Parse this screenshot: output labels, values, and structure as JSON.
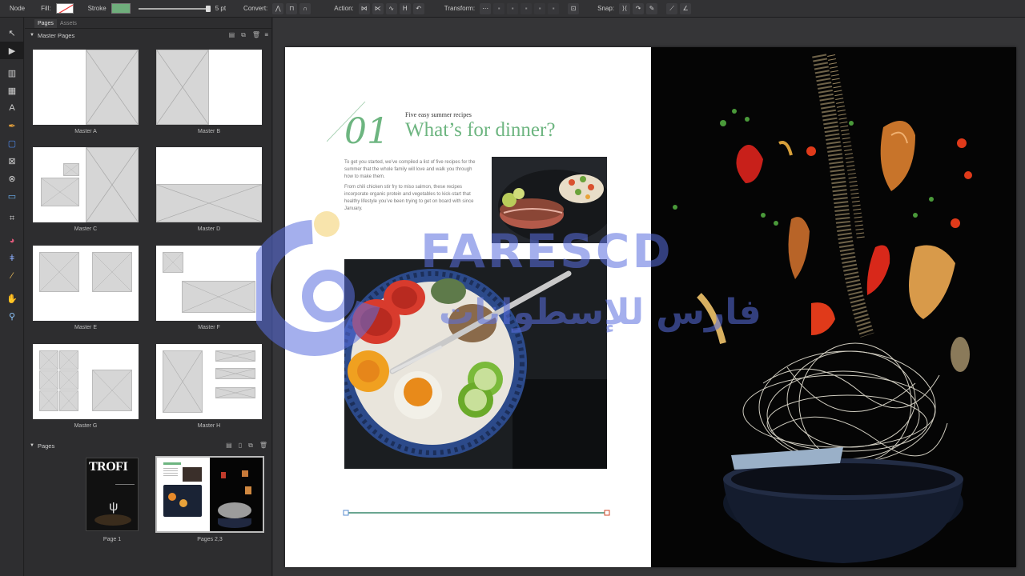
{
  "toolbar_top": {
    "node_label": "Node",
    "fill_label": "Fill:",
    "stroke_label": "Stroke",
    "stroke_width": "5 pt",
    "convert_label": "Convert:",
    "action_label": "Action:",
    "transform_label": "Transform:",
    "snap_label": "Snap:",
    "colors": {
      "stroke_swatch": "#6fae7c",
      "fill_swatch": "#ffffff"
    }
  },
  "panel": {
    "tabs": [
      "Pages",
      "Assets"
    ],
    "master_pages_title": "Master Pages",
    "masters": [
      "Master A",
      "Master B",
      "Master C",
      "Master D",
      "Master E",
      "Master F",
      "Master G",
      "Master H"
    ],
    "pages_title": "Pages",
    "pages": [
      "Page 1",
      "Pages 2,3"
    ],
    "cover_title": "TROFI"
  },
  "document": {
    "number": "01",
    "kicker": "Five easy summer recipes",
    "headline": "What’s for dinner?",
    "paragraph1": "To get you started, we’ve compiled a list of five recipes for the summer that the whole family will love and walk you through how to make them.",
    "paragraph2": "From chili chicken stir fry to miso salmon, these recipes incorporate organic protein and vegetables to kick-start that healthy lifestyle you’ve been trying to get on board with since January.",
    "accent_color": "#6db580"
  },
  "watermark": {
    "latin": "FARESCD",
    "arabic": "فارس للإسطوانات"
  }
}
